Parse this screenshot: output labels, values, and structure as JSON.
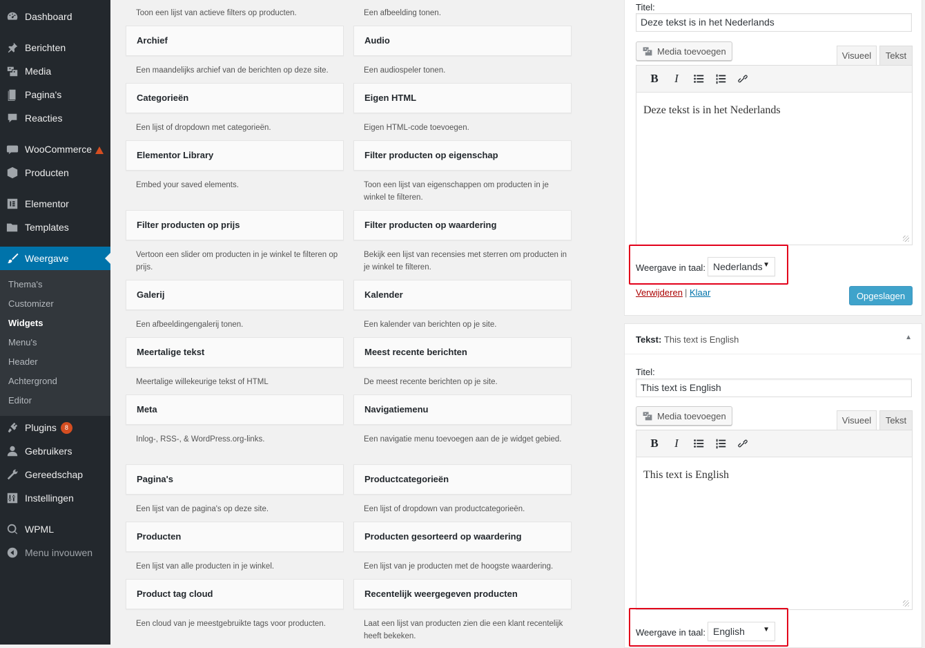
{
  "sidebar": {
    "items": [
      {
        "label": "Dashboard",
        "icon": "dashboard-icon"
      },
      {
        "label": "Berichten",
        "icon": "pin-icon"
      },
      {
        "label": "Media",
        "icon": "media-icon"
      },
      {
        "label": "Pagina's",
        "icon": "page-icon"
      },
      {
        "label": "Reacties",
        "icon": "comment-icon"
      },
      {
        "label": "WooCommerce",
        "icon": "woocommerce-icon"
      },
      {
        "label": "Producten",
        "icon": "product-icon"
      },
      {
        "label": "Elementor",
        "icon": "elementor-icon"
      },
      {
        "label": "Templates",
        "icon": "folder-icon"
      },
      {
        "label": "Weergave",
        "icon": "brush-icon"
      },
      {
        "label": "Plugins",
        "icon": "plugin-icon",
        "badge": "8"
      },
      {
        "label": "Gebruikers",
        "icon": "user-icon"
      },
      {
        "label": "Gereedschap",
        "icon": "wrench-icon"
      },
      {
        "label": "Instellingen",
        "icon": "settings-icon"
      },
      {
        "label": "WPML",
        "icon": "wpml-icon"
      },
      {
        "label": "Menu invouwen",
        "icon": "collapse-icon"
      }
    ],
    "submenu": [
      "Thema's",
      "Customizer",
      "Widgets",
      "Menu's",
      "Header",
      "Achtergrond",
      "Editor"
    ]
  },
  "widgets": {
    "top_descs": [
      "Toon een lijst van actieve filters op producten.",
      "Een afbeelding tonen."
    ],
    "items": [
      {
        "title": "Archief",
        "desc": "Een maandelijks archief van de berichten op deze site."
      },
      {
        "title": "Audio",
        "desc": "Een audiospeler tonen."
      },
      {
        "title": "Categorieën",
        "desc": "Een lijst of dropdown met categorieën."
      },
      {
        "title": "Eigen HTML",
        "desc": "Eigen HTML-code toevoegen."
      },
      {
        "title": "Elementor Library",
        "desc": "Embed your saved elements."
      },
      {
        "title": "Filter producten op eigenschap",
        "desc": "Toon een lijst van eigenschappen om producten in je winkel te filteren."
      },
      {
        "title": "Filter producten op prijs",
        "desc": "Vertoon een slider om producten in je winkel te filteren op prijs."
      },
      {
        "title": "Filter producten op waardering",
        "desc": "Bekijk een lijst van recensies met sterren om producten in je winkel te filteren."
      },
      {
        "title": "Galerij",
        "desc": "Een afbeeldingengalerij tonen."
      },
      {
        "title": "Kalender",
        "desc": "Een kalender van berichten op je site."
      },
      {
        "title": "Meertalige tekst",
        "desc": "Meertalige willekeurige tekst of HTML"
      },
      {
        "title": "Meest recente berichten",
        "desc": "De meest recente berichten op je site."
      },
      {
        "title": "Meta",
        "desc": "Inlog-, RSS-, & WordPress.org-links."
      },
      {
        "title": "Navigatiemenu",
        "desc": "Een navigatie menu toevoegen aan de je widget gebied."
      },
      {
        "title": "Pagina's",
        "desc": "Een lijst van de pagina's op deze site."
      },
      {
        "title": "Productcategorieën",
        "desc": "Een lijst of dropdown van productcategorieën."
      },
      {
        "title": "Producten",
        "desc": "Een lijst van alle producten in je winkel."
      },
      {
        "title": "Producten gesorteerd op waardering",
        "desc": "Een lijst van je producten met de hoogste waardering."
      },
      {
        "title": "Product tag cloud",
        "desc": "Een cloud van je meestgebruikte tags voor producten."
      },
      {
        "title": "Recentelijk weergegeven producten",
        "desc": "Laat een lijst van producten zien die een klant recentelijk heeft bekeken."
      }
    ]
  },
  "panel1": {
    "title_label": "Titel:",
    "title_value": "Deze tekst is in het Nederlands",
    "media_button": "Media toevoegen",
    "tab_visual": "Visueel",
    "tab_text": "Tekst",
    "editor_content": "Deze tekst is in het Nederlands",
    "lang_label": "Weergave in taal:",
    "lang_value": "Nederlands",
    "delete_link": "Verwijderen",
    "separator": "|",
    "done_link": "Klaar",
    "save_button": "Opgeslagen"
  },
  "panel2": {
    "header_type": "Tekst:",
    "header_title": "This text is English",
    "title_label": "Titel:",
    "title_value": "This text is English",
    "media_button": "Media toevoegen",
    "tab_visual": "Visueel",
    "tab_text": "Tekst",
    "editor_content": "This text is English",
    "lang_label": "Weergave in taal:",
    "lang_value": "English"
  },
  "colors": {
    "sidebar_bg": "#23282d",
    "submenu_bg": "#32373c",
    "active_accent": "#0073aa",
    "badge": "#d54e21",
    "highlight_box": "#e2001a",
    "primary_button": "#0085ba"
  }
}
